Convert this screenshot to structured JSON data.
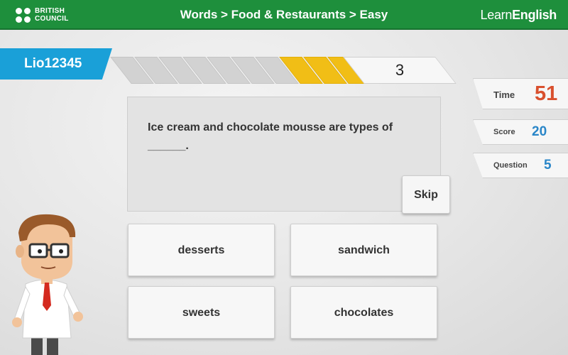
{
  "header": {
    "brand_line1": "BRITISH",
    "brand_line2": "COUNCIL",
    "breadcrumb": "Words > Food & Restaurants > Easy",
    "app_name_light": "Learn",
    "app_name_bold": "English"
  },
  "user": {
    "name": "Lio12345"
  },
  "progress": {
    "current": "3",
    "completed_segments": 3,
    "total_segments": 10
  },
  "question": {
    "text": "Ice cream and chocolate mousse are types of",
    "blank": "______."
  },
  "skip_label": "Skip",
  "answers": [
    "desserts",
    "sandwich",
    "sweets",
    "chocolates"
  ],
  "stats": {
    "time_label": "Time",
    "time_value": "51",
    "score_label": "Score",
    "score_value": "20",
    "question_label": "Question",
    "question_value": "5"
  },
  "colors": {
    "header_green": "#1e8f3c",
    "user_blue": "#1aa0d8",
    "progress_yellow": "#f1be16",
    "time_red": "#d9502e",
    "stat_blue": "#2a86c8"
  },
  "icons": {
    "logo": "british-council-logo",
    "mascot": "teacher-character"
  }
}
